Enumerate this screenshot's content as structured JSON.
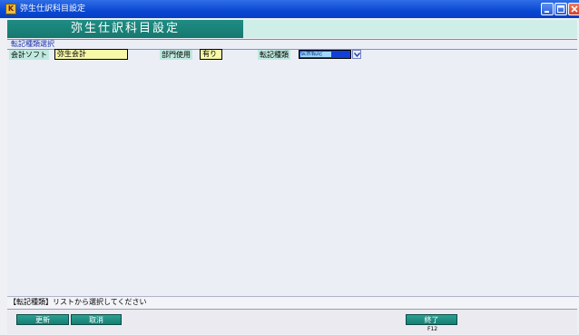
{
  "window": {
    "title": "弥生仕訳科目設定",
    "icon_letter": "K"
  },
  "header": {
    "title": "弥生仕訳科目設定"
  },
  "section": {
    "label": "転記種類選択"
  },
  "fields": {
    "software": {
      "label": "会計ソフト",
      "value": "弥生会計"
    },
    "department": {
      "label": "部門使用",
      "value": "有り"
    },
    "transfer_type": {
      "label": "転記種類",
      "value": "伝票転記"
    }
  },
  "status": {
    "message": "【転記種類】リストから選択してください"
  },
  "buttons": {
    "update": "更新",
    "cancel": "取消",
    "finish": "終了",
    "finish_key": "F12"
  },
  "colors": {
    "titlebar": "#0a48d2",
    "header": "#167870",
    "button": "#1f8d84",
    "input_bg": "#f7f9a8"
  }
}
